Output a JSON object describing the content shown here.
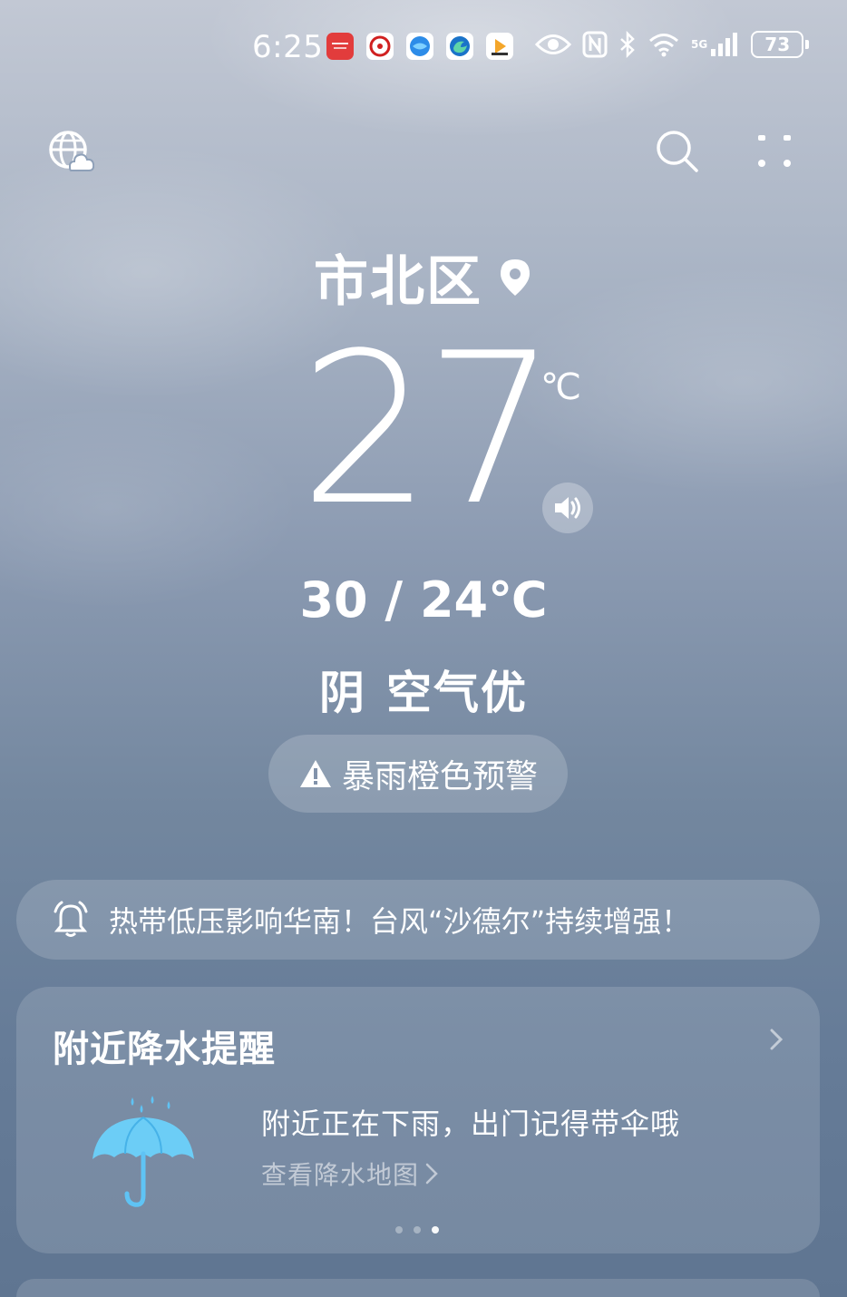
{
  "status_bar": {
    "time": "6:25",
    "app_icons": [
      "huawei-icon",
      "ttl-icon",
      "browser-icon",
      "edge-icon",
      "video-icon"
    ],
    "battery": "73",
    "network": "5G"
  },
  "header": {
    "city": "市北区"
  },
  "current": {
    "temperature": "27",
    "unit": "℃",
    "high_low": "30 / 24℃",
    "condition": "阴",
    "air_quality": "空气优"
  },
  "alert": {
    "label": "暴雨橙色预警"
  },
  "news": {
    "text": "热带低压影响华南！台风“沙德尔”持续增强！"
  },
  "precip_card": {
    "title": "附近降水提醒",
    "message": "附近正在下雨，出门记得带伞哦",
    "link": "查看降水地图"
  },
  "colors": {
    "umbrella": "#5fc3f4",
    "alert_icon": "#ffffff"
  }
}
